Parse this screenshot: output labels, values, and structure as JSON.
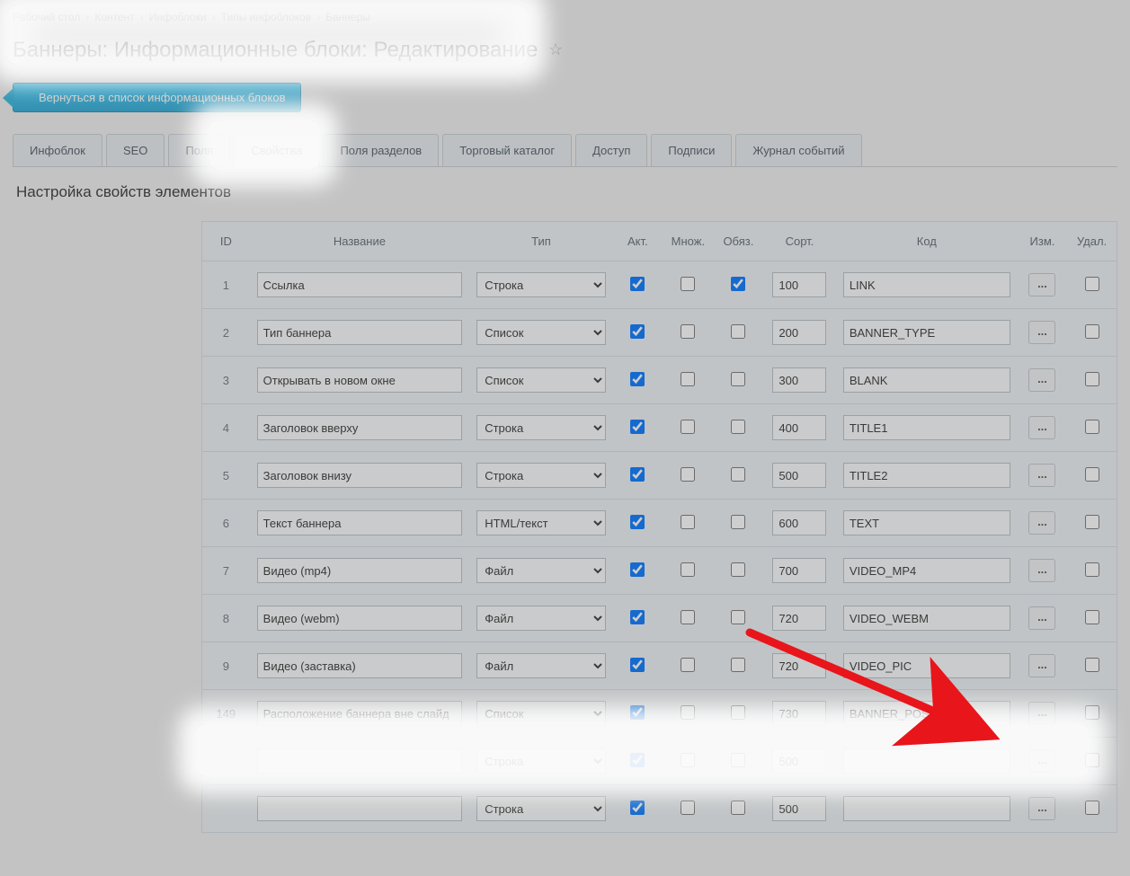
{
  "breadcrumb": [
    "Рабочий стол",
    "Контент",
    "Инфоблоки",
    "Типы инфоблоков",
    "Баннеры"
  ],
  "page_title": "Баннеры: Информационные блоки: Редактирование",
  "back_button": "Вернуться в список информационных блоков",
  "tabs": [
    {
      "label": "Инфоблок",
      "active": false
    },
    {
      "label": "SEO",
      "active": false
    },
    {
      "label": "Поля",
      "active": false
    },
    {
      "label": "Свойства",
      "active": true
    },
    {
      "label": "Поля разделов",
      "active": false
    },
    {
      "label": "Торговый каталог",
      "active": false
    },
    {
      "label": "Доступ",
      "active": false
    },
    {
      "label": "Подписи",
      "active": false
    },
    {
      "label": "Журнал событий",
      "active": false
    }
  ],
  "section_heading": "Настройка свойств элементов",
  "columns": {
    "id": "ID",
    "name": "Название",
    "type": "Тип",
    "active": "Акт.",
    "multiple": "Множ.",
    "required": "Обяз.",
    "sort": "Сорт.",
    "code": "Код",
    "edit": "Изм.",
    "del": "Удал."
  },
  "type_options": [
    "Строка",
    "Список",
    "HTML/текст",
    "Файл"
  ],
  "edit_btn_label": "...",
  "rows": [
    {
      "id": "1",
      "name": "Ссылка",
      "type": "Строка",
      "active": true,
      "multiple": false,
      "required": true,
      "sort": "100",
      "code": "LINK"
    },
    {
      "id": "2",
      "name": "Тип баннера",
      "type": "Список",
      "active": true,
      "multiple": false,
      "required": false,
      "sort": "200",
      "code": "BANNER_TYPE"
    },
    {
      "id": "3",
      "name": "Открывать в новом окне",
      "type": "Список",
      "active": true,
      "multiple": false,
      "required": false,
      "sort": "300",
      "code": "BLANK"
    },
    {
      "id": "4",
      "name": "Заголовок вверху",
      "type": "Строка",
      "active": true,
      "multiple": false,
      "required": false,
      "sort": "400",
      "code": "TITLE1"
    },
    {
      "id": "5",
      "name": "Заголовок внизу",
      "type": "Строка",
      "active": true,
      "multiple": false,
      "required": false,
      "sort": "500",
      "code": "TITLE2"
    },
    {
      "id": "6",
      "name": "Текст баннера",
      "type": "HTML/текст",
      "active": true,
      "multiple": false,
      "required": false,
      "sort": "600",
      "code": "TEXT"
    },
    {
      "id": "7",
      "name": "Видео (mp4)",
      "type": "Файл",
      "active": true,
      "multiple": false,
      "required": false,
      "sort": "700",
      "code": "VIDEO_MP4"
    },
    {
      "id": "8",
      "name": "Видео (webm)",
      "type": "Файл",
      "active": true,
      "multiple": false,
      "required": false,
      "sort": "720",
      "code": "VIDEO_WEBM"
    },
    {
      "id": "9",
      "name": "Видео (заставка)",
      "type": "Файл",
      "active": true,
      "multiple": false,
      "required": false,
      "sort": "720",
      "code": "VIDEO_PIC"
    },
    {
      "id": "149",
      "name": "Расположение баннера вне слайд",
      "type": "Список",
      "active": true,
      "multiple": false,
      "required": false,
      "sort": "730",
      "code": "BANNER_POSITION"
    },
    {
      "id": "",
      "name": "",
      "type": "Строка",
      "active": true,
      "multiple": false,
      "required": false,
      "sort": "500",
      "code": ""
    },
    {
      "id": "",
      "name": "",
      "type": "Строка",
      "active": true,
      "multiple": false,
      "required": false,
      "sort": "500",
      "code": ""
    }
  ]
}
